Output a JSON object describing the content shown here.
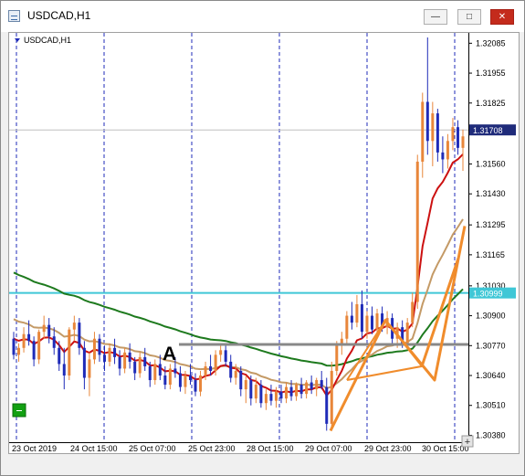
{
  "window": {
    "title": "USDCAD,H1",
    "buttons": {
      "minimize": "—",
      "maximize": "□",
      "close": "✕"
    }
  },
  "chart_data": {
    "type": "candlestick",
    "symbol_label": "USDCAD,H1",
    "price_ticks": [
      "1.32085",
      "1.31955",
      "1.31825",
      "1.31560",
      "1.31430",
      "1.31295",
      "1.31165",
      "1.31030",
      "1.30900",
      "1.30770",
      "1.30640",
      "1.30510",
      "1.30380"
    ],
    "price_labels": {
      "current": "1.31708",
      "horizontal_line": "1.30999"
    },
    "time_ticks": [
      "23 Oct 2019",
      "24 Oct 15:00",
      "25 Oct 07:00",
      "25 Oct 23:00",
      "28 Oct 15:00",
      "29 Oct 07:00",
      "29 Oct 23:00",
      "30 Oct 15:00"
    ],
    "annotation": "A",
    "ylim": [
      1.3035,
      1.3213
    ],
    "colors": {
      "bull": "#e8863a",
      "bear": "#1f2bb8",
      "ma_fast": "#cc1111",
      "ma_mid": "#c49a66",
      "ma_slow": "#1e7a1e",
      "hline": "#3fc7d6",
      "drawing": "#f08c2c",
      "levelA": "#888888"
    },
    "candles": [
      [
        1.308,
        1.3083,
        1.3071,
        1.3073
      ],
      [
        1.3073,
        1.3078,
        1.307,
        1.3076
      ],
      [
        1.3076,
        1.3085,
        1.3074,
        1.3082
      ],
      [
        1.3082,
        1.3088,
        1.3077,
        1.3079
      ],
      [
        1.3079,
        1.3081,
        1.3068,
        1.3071
      ],
      [
        1.3071,
        1.3084,
        1.3069,
        1.3083
      ],
      [
        1.3083,
        1.309,
        1.308,
        1.3086
      ],
      [
        1.3086,
        1.3089,
        1.3078,
        1.3081
      ],
      [
        1.3081,
        1.3085,
        1.3073,
        1.3076
      ],
      [
        1.3076,
        1.3079,
        1.3066,
        1.3069
      ],
      [
        1.3069,
        1.3076,
        1.3058,
        1.3064
      ],
      [
        1.3064,
        1.3085,
        1.3062,
        1.3084
      ],
      [
        1.3084,
        1.309,
        1.3079,
        1.3087
      ],
      [
        1.3087,
        1.3089,
        1.3073,
        1.3076
      ],
      [
        1.3076,
        1.3079,
        1.3058,
        1.3063
      ],
      [
        1.3063,
        1.3074,
        1.3055,
        1.3071
      ],
      [
        1.3071,
        1.3083,
        1.3069,
        1.308
      ],
      [
        1.308,
        1.3082,
        1.307,
        1.3073
      ],
      [
        1.3073,
        1.3077,
        1.3066,
        1.307
      ],
      [
        1.307,
        1.3078,
        1.3068,
        1.3076
      ],
      [
        1.3076,
        1.308,
        1.3069,
        1.3072
      ],
      [
        1.3072,
        1.3075,
        1.3064,
        1.3067
      ],
      [
        1.3067,
        1.3076,
        1.3065,
        1.3074
      ],
      [
        1.3074,
        1.3078,
        1.3067,
        1.307
      ],
      [
        1.307,
        1.3072,
        1.3062,
        1.3065
      ],
      [
        1.3065,
        1.3074,
        1.3063,
        1.3072
      ],
      [
        1.3072,
        1.3076,
        1.3066,
        1.3068
      ],
      [
        1.3068,
        1.307,
        1.3059,
        1.3062
      ],
      [
        1.3062,
        1.3071,
        1.306,
        1.3069
      ],
      [
        1.3069,
        1.3073,
        1.3062,
        1.3064
      ],
      [
        1.3064,
        1.3068,
        1.3058,
        1.306
      ],
      [
        1.306,
        1.3069,
        1.3058,
        1.3067
      ],
      [
        1.3067,
        1.3072,
        1.3063,
        1.3065
      ],
      [
        1.3065,
        1.3068,
        1.3057,
        1.3059
      ],
      [
        1.3059,
        1.3066,
        1.3056,
        1.3064
      ],
      [
        1.3064,
        1.3069,
        1.306,
        1.3062
      ],
      [
        1.3062,
        1.3065,
        1.3055,
        1.3057
      ],
      [
        1.3057,
        1.3066,
        1.3055,
        1.3064
      ],
      [
        1.3064,
        1.307,
        1.3062,
        1.3068
      ],
      [
        1.3068,
        1.3073,
        1.3064,
        1.3066
      ],
      [
        1.3066,
        1.3075,
        1.3064,
        1.3073
      ],
      [
        1.3073,
        1.3078,
        1.307,
        1.3075
      ],
      [
        1.3075,
        1.3078,
        1.3068,
        1.307
      ],
      [
        1.307,
        1.3073,
        1.3061,
        1.3063
      ],
      [
        1.3063,
        1.3069,
        1.306,
        1.3066
      ],
      [
        1.3066,
        1.3068,
        1.3055,
        1.3058
      ],
      [
        1.3058,
        1.3064,
        1.3052,
        1.3062
      ],
      [
        1.3062,
        1.3064,
        1.3051,
        1.3054
      ],
      [
        1.3054,
        1.3063,
        1.3052,
        1.306
      ],
      [
        1.306,
        1.3062,
        1.305,
        1.3052
      ],
      [
        1.3052,
        1.3058,
        1.3049,
        1.3056
      ],
      [
        1.3056,
        1.306,
        1.3051,
        1.3053
      ],
      [
        1.3053,
        1.3059,
        1.305,
        1.3057
      ],
      [
        1.3057,
        1.306,
        1.3052,
        1.3054
      ],
      [
        1.3054,
        1.3061,
        1.3052,
        1.3059
      ],
      [
        1.3059,
        1.3062,
        1.3053,
        1.3055
      ],
      [
        1.3055,
        1.3061,
        1.3053,
        1.306
      ],
      [
        1.306,
        1.3063,
        1.3054,
        1.3056
      ],
      [
        1.3056,
        1.3062,
        1.3054,
        1.3061
      ],
      [
        1.3061,
        1.3064,
        1.3056,
        1.3058
      ],
      [
        1.3058,
        1.3063,
        1.3055,
        1.3062
      ],
      [
        1.3062,
        1.3066,
        1.3058,
        1.3059
      ],
      [
        1.3059,
        1.3063,
        1.304,
        1.3043
      ],
      [
        1.3043,
        1.307,
        1.304,
        1.3066
      ],
      [
        1.3066,
        1.3079,
        1.3064,
        1.3077
      ],
      [
        1.3077,
        1.3083,
        1.3073,
        1.308
      ],
      [
        1.308,
        1.3092,
        1.3077,
        1.309
      ],
      [
        1.309,
        1.3096,
        1.3084,
        1.3087
      ],
      [
        1.3087,
        1.3099,
        1.3085,
        1.3095
      ],
      [
        1.3095,
        1.3101,
        1.308,
        1.3083
      ],
      [
        1.3083,
        1.3092,
        1.308,
        1.309
      ],
      [
        1.309,
        1.3094,
        1.3082,
        1.3084
      ],
      [
        1.3084,
        1.3093,
        1.3082,
        1.3091
      ],
      [
        1.3091,
        1.3094,
        1.3083,
        1.3085
      ],
      [
        1.3085,
        1.3092,
        1.3082,
        1.3089
      ],
      [
        1.3089,
        1.3091,
        1.3078,
        1.308
      ],
      [
        1.308,
        1.3087,
        1.3076,
        1.3085
      ],
      [
        1.3085,
        1.3088,
        1.3076,
        1.3078
      ],
      [
        1.3078,
        1.3089,
        1.3076,
        1.3087
      ],
      [
        1.3087,
        1.31,
        1.3085,
        1.3096
      ],
      [
        1.3096,
        1.316,
        1.3093,
        1.3157
      ],
      [
        1.3157,
        1.3187,
        1.315,
        1.3183
      ],
      [
        1.3183,
        1.3211,
        1.316,
        1.3166
      ],
      [
        1.3166,
        1.3183,
        1.3155,
        1.3178
      ],
      [
        1.3178,
        1.318,
        1.3157,
        1.3161
      ],
      [
        1.3161,
        1.3168,
        1.3152,
        1.3158
      ],
      [
        1.3158,
        1.3169,
        1.3154,
        1.3166
      ],
      [
        1.3166,
        1.3176,
        1.3162,
        1.3172
      ],
      [
        1.3172,
        1.3175,
        1.316,
        1.3163
      ],
      [
        1.3163,
        1.3171,
        1.3153,
        1.3168
      ]
    ]
  }
}
